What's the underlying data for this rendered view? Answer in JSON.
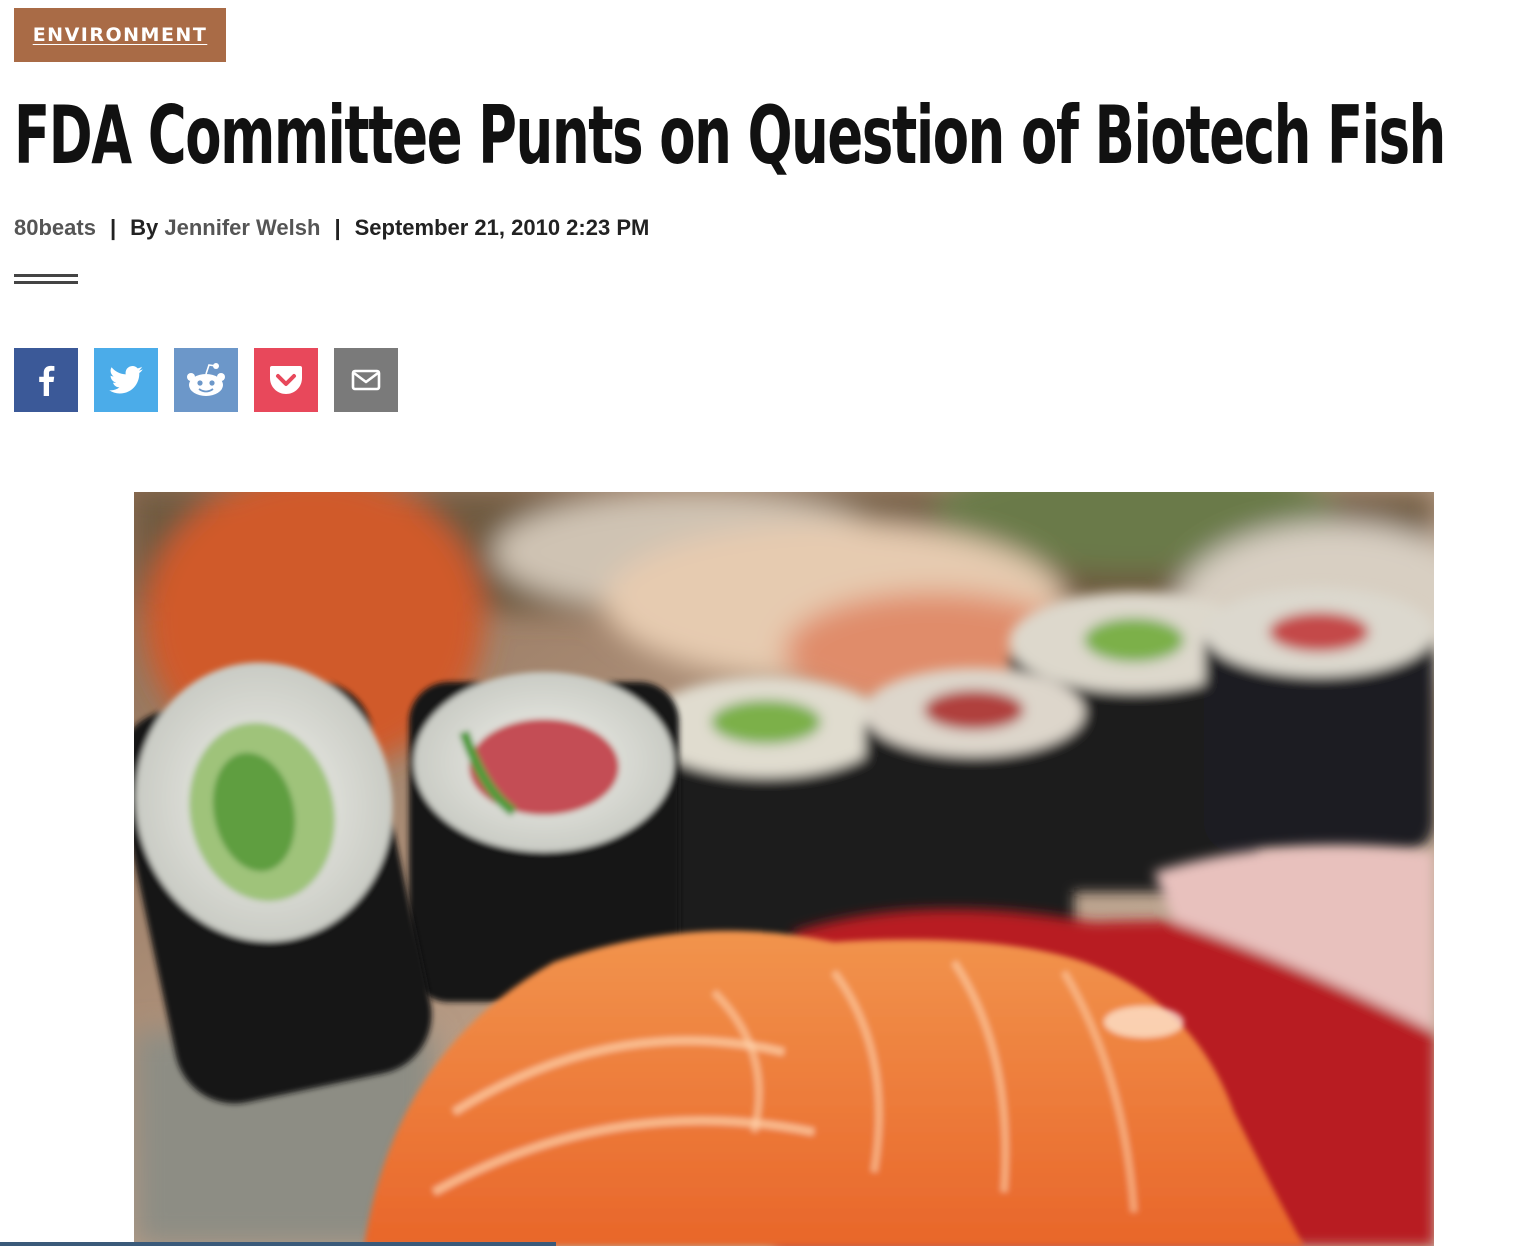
{
  "category": {
    "label": "ENVIRONMENT",
    "color": "#a96b46"
  },
  "headline": "FDA Committee Punts on Question of Biotech Fish",
  "byline": {
    "blog": "80beats",
    "separator": "|",
    "by_prefix": "By",
    "author": "Jennifer Welsh",
    "date": "September 21, 2010 2:23 PM"
  },
  "share": [
    {
      "name": "facebook",
      "icon": "facebook-icon",
      "color": "#3b5998"
    },
    {
      "name": "twitter",
      "icon": "twitter-icon",
      "color": "#4bace9"
    },
    {
      "name": "reddit",
      "icon": "reddit-icon",
      "color": "#6c97c9"
    },
    {
      "name": "pocket",
      "icon": "pocket-icon",
      "color": "#e8485b"
    },
    {
      "name": "email",
      "icon": "email-icon",
      "color": "#7a7a7a"
    }
  ],
  "hero_image": {
    "subject": "sushi"
  }
}
